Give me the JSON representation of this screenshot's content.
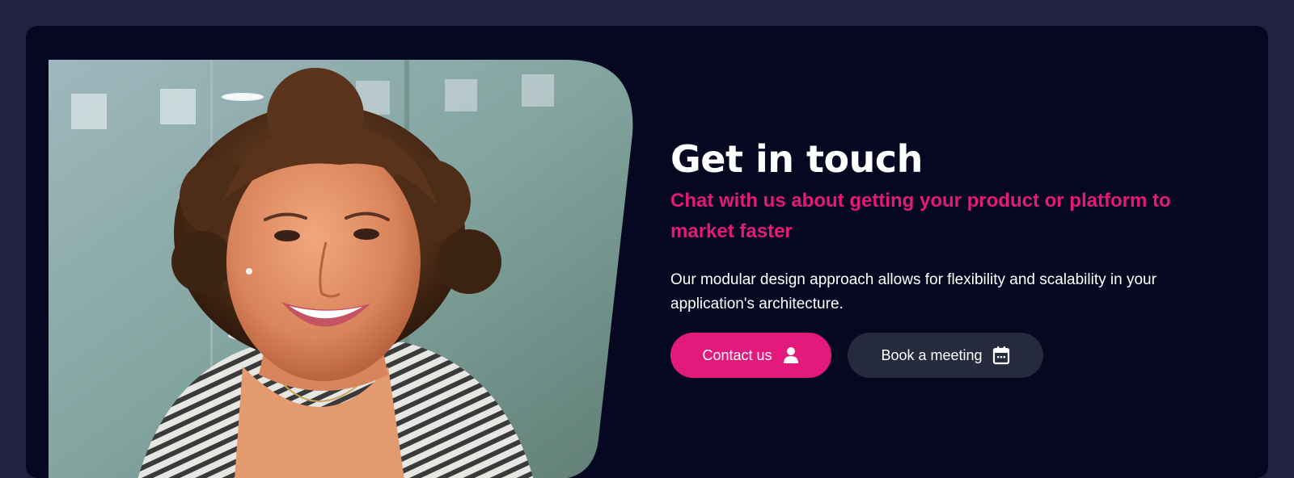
{
  "hero": {
    "title": "Get in touch",
    "subtitle": "Chat with us about getting your product or platform to market faster",
    "description": "Our modular design approach allows for flexibility and scalability in your application's architecture.",
    "photo_alt": "Smiling woman with curly hair in an office"
  },
  "actions": {
    "contact_label": "Contact us",
    "contact_icon": "user-icon",
    "meeting_label": "Book a meeting",
    "meeting_icon": "calendar-icon"
  },
  "colors": {
    "page_background": "#202240",
    "card_background": "#050820",
    "accent": "#e3197c",
    "secondary_button": "#262a3d",
    "text": "#ffffff"
  }
}
